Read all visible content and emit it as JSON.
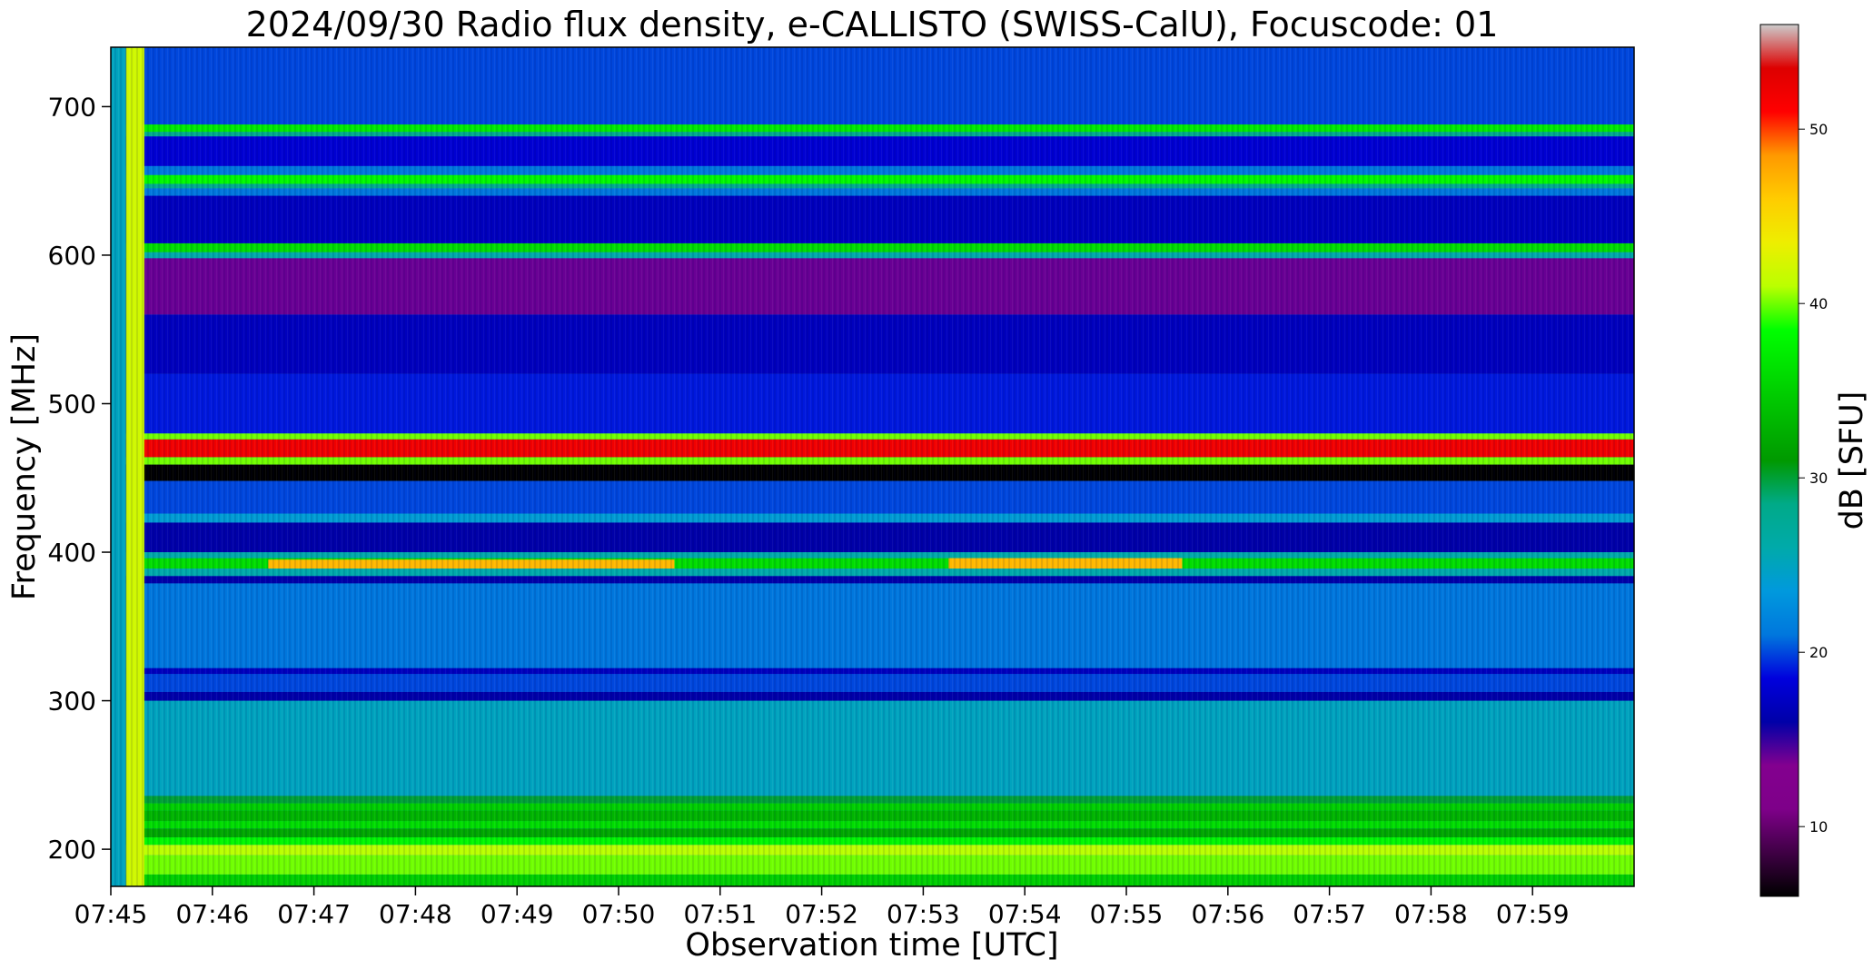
{
  "chart_data": {
    "type": "heatmap",
    "title": "2024/09/30  Radio flux density, e-CALLISTO (SWISS-CalU), Focuscode: 01",
    "xlabel": "Observation time [UTC]",
    "ylabel": "Frequency [MHz]",
    "x_tick_labels": [
      "07:45",
      "07:46",
      "07:47",
      "07:48",
      "07:49",
      "07:50",
      "07:51",
      "07:52",
      "07:53",
      "07:54",
      "07:55",
      "07:56",
      "07:57",
      "07:58",
      "07:59"
    ],
    "x_range_minutes": [
      0,
      15
    ],
    "y_tick_values": [
      200,
      300,
      400,
      500,
      600,
      700
    ],
    "y_tick_labels": [
      "200",
      "300",
      "400",
      "500",
      "600",
      "700"
    ],
    "ylim": [
      175,
      740
    ],
    "colorbar": {
      "label": "dB [SFU]",
      "range": [
        6,
        56
      ],
      "tick_values": [
        10,
        20,
        30,
        40,
        50
      ],
      "tick_labels": [
        "10",
        "20",
        "30",
        "40",
        "50"
      ],
      "colormap": "nipy_spectral"
    },
    "background_level_db": 21,
    "frequency_bands": [
      {
        "f_low": 175,
        "f_high": 183,
        "db": 35
      },
      {
        "f_low": 183,
        "f_high": 196,
        "db": 40
      },
      {
        "f_low": 196,
        "f_high": 203,
        "db": 41
      },
      {
        "f_low": 203,
        "f_high": 208,
        "db": 38
      },
      {
        "f_low": 208,
        "f_high": 214,
        "db": 32
      },
      {
        "f_low": 214,
        "f_high": 219,
        "db": 36
      },
      {
        "f_low": 219,
        "f_high": 226,
        "db": 33
      },
      {
        "f_low": 226,
        "f_high": 231,
        "db": 35
      },
      {
        "f_low": 231,
        "f_high": 236,
        "db": 30
      },
      {
        "f_low": 236,
        "f_high": 300,
        "db": 25
      },
      {
        "f_low": 300,
        "f_high": 306,
        "db": 16
      },
      {
        "f_low": 306,
        "f_high": 318,
        "db": 20
      },
      {
        "f_low": 318,
        "f_high": 322,
        "db": 17
      },
      {
        "f_low": 322,
        "f_high": 379,
        "db": 21
      },
      {
        "f_low": 379,
        "f_high": 384,
        "db": 16
      },
      {
        "f_low": 384,
        "f_high": 389,
        "db": 26
      },
      {
        "f_low": 389,
        "f_high": 396,
        "db": 36
      },
      {
        "f_low": 396,
        "f_high": 400,
        "db": 26
      },
      {
        "f_low": 400,
        "f_high": 420,
        "db": 16
      },
      {
        "f_low": 420,
        "f_high": 426,
        "db": 24
      },
      {
        "f_low": 426,
        "f_high": 448,
        "db": 20
      },
      {
        "f_low": 448,
        "f_high": 459,
        "db": 6
      },
      {
        "f_low": 459,
        "f_high": 464,
        "db": 40
      },
      {
        "f_low": 464,
        "f_high": 476,
        "db": 52
      },
      {
        "f_low": 476,
        "f_high": 480,
        "db": 40
      },
      {
        "f_low": 480,
        "f_high": 520,
        "db": 19
      },
      {
        "f_low": 520,
        "f_high": 560,
        "db": 17
      },
      {
        "f_low": 560,
        "f_high": 598,
        "db": 14
      },
      {
        "f_low": 598,
        "f_high": 602,
        "db": 26
      },
      {
        "f_low": 602,
        "f_high": 608,
        "db": 36
      },
      {
        "f_low": 608,
        "f_high": 640,
        "db": 17
      },
      {
        "f_low": 640,
        "f_high": 645,
        "db": 21
      },
      {
        "f_low": 645,
        "f_high": 648,
        "db": 28
      },
      {
        "f_low": 648,
        "f_high": 654,
        "db": 38
      },
      {
        "f_low": 654,
        "f_high": 660,
        "db": 21
      },
      {
        "f_low": 660,
        "f_high": 680,
        "db": 18
      },
      {
        "f_low": 680,
        "f_high": 683,
        "db": 28
      },
      {
        "f_low": 683,
        "f_high": 688,
        "db": 37
      },
      {
        "f_low": 688,
        "f_high": 740,
        "db": 20
      }
    ],
    "vertical_features": [
      {
        "t_start_min": 0.0,
        "t_end_min": 0.15,
        "db": 25
      },
      {
        "t_start_min": 0.15,
        "t_end_min": 0.15,
        "db": 16
      },
      {
        "t_start_min": 0.15,
        "t_end_min": 0.33,
        "db": 42
      }
    ],
    "transient_segments": [
      {
        "t_start_min": 1.55,
        "t_end_min": 5.55,
        "f_low": 389,
        "f_high": 395,
        "db": 47
      },
      {
        "t_start_min": 8.25,
        "t_end_min": 10.55,
        "f_low": 389,
        "f_high": 396,
        "db": 47
      }
    ]
  }
}
